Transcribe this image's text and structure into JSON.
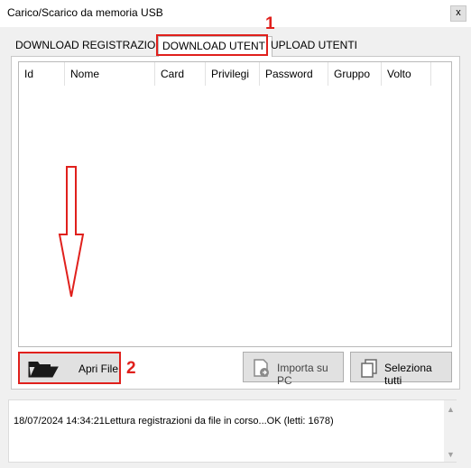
{
  "window": {
    "title": "Carico/Scarico da memoria USB",
    "close_label": "x"
  },
  "tabs": [
    {
      "label": "DOWNLOAD REGISTRAZIONI",
      "selected": false
    },
    {
      "label": "DOWNLOAD UTENTI",
      "selected": true
    },
    {
      "label": "UPLOAD UTENTI",
      "selected": false
    }
  ],
  "table": {
    "columns": [
      "Id",
      "Nome",
      "Card",
      "Privilegi",
      "Password",
      "Gruppo",
      "Volto"
    ],
    "rows": []
  },
  "buttons": {
    "apri_file": "Apri File",
    "importa_su_pc": "Importa su PC",
    "seleziona_tutti": "Seleziona tutti"
  },
  "annotations": {
    "marker_1": "1",
    "marker_2": "2"
  },
  "log": {
    "text": "18/07/2024 14:34:21Lettura registrazioni da file in corso...OK (letti: 1678)"
  },
  "colors": {
    "annotation_red": "#e0201c",
    "window_bg": "#f0f0f0",
    "button_bg": "#e1e1e1"
  },
  "icons": [
    "folder-icon",
    "import-icon",
    "select-all-icon",
    "arrow-down-annotation-icon"
  ]
}
